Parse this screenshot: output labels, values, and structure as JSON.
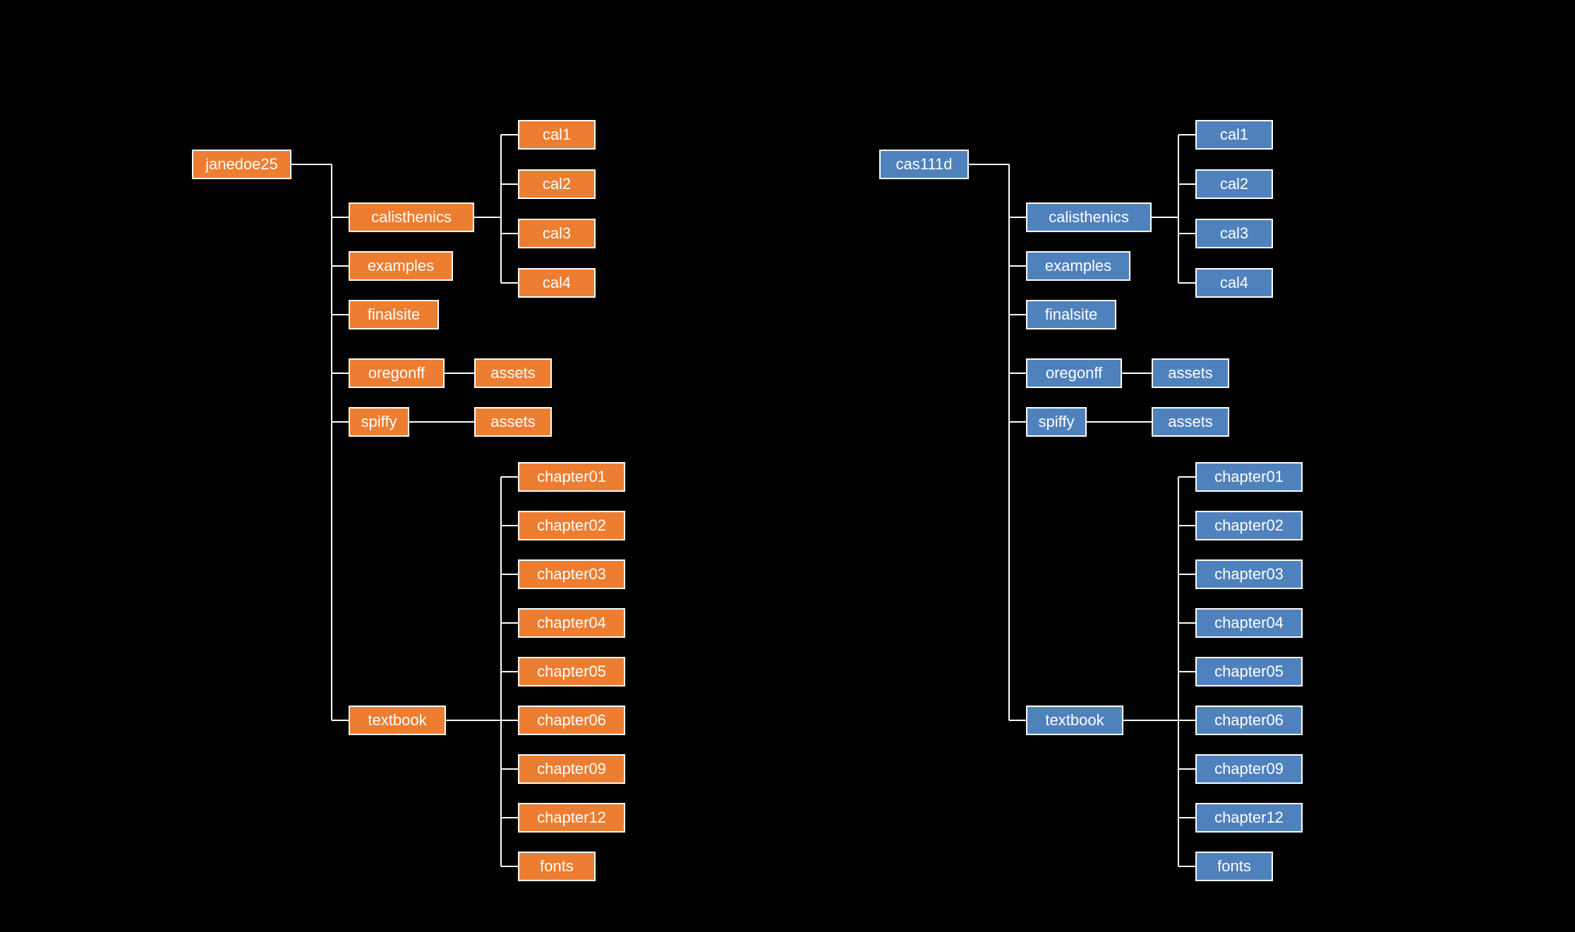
{
  "colors": {
    "orange": "#ED7D31",
    "blue": "#4F81BD",
    "wire": "#FFFFFF"
  },
  "trees": [
    {
      "root": "janedoe25",
      "color": "orange",
      "children": [
        {
          "label": "calisthenics",
          "children": [
            "cal1",
            "cal2",
            "cal3",
            "cal4"
          ]
        },
        {
          "label": "examples"
        },
        {
          "label": "finalsite"
        },
        {
          "label": "oregonff",
          "children": [
            "assets"
          ]
        },
        {
          "label": "spiffy",
          "children": [
            "assets"
          ]
        },
        {
          "label": "textbook",
          "children": [
            "chapter01",
            "chapter02",
            "chapter03",
            "chapter04",
            "chapter05",
            "chapter06",
            "chapter09",
            "chapter12",
            "fonts"
          ]
        }
      ]
    },
    {
      "root": "cas111d",
      "color": "blue",
      "children": [
        {
          "label": "calisthenics",
          "children": [
            "cal1",
            "cal2",
            "cal3",
            "cal4"
          ]
        },
        {
          "label": "examples"
        },
        {
          "label": "finalsite"
        },
        {
          "label": "oregonff",
          "children": [
            "assets"
          ]
        },
        {
          "label": "spiffy",
          "children": [
            "assets"
          ]
        },
        {
          "label": "textbook",
          "children": [
            "chapter01",
            "chapter02",
            "chapter03",
            "chapter04",
            "chapter05",
            "chapter06",
            "chapter09",
            "chapter12",
            "fonts"
          ]
        }
      ]
    }
  ]
}
